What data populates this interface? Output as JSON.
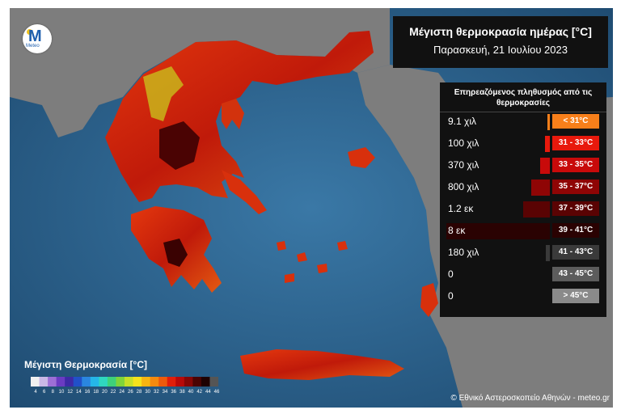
{
  "logo": {
    "letter": "M",
    "text": "Meteo"
  },
  "title": "Μέγιστη θερμοκρασία ημέρας [°C]",
  "subtitle": "Παρασκευή, 21 Ιουλίου 2023",
  "population_panel": {
    "title": "Επηρεαζόμενος πληθυσμός από τις θερμοκρασίες",
    "rows": [
      {
        "population": "9.1 χιλ",
        "range": "< 31°C",
        "color": "#f77f1a",
        "bar_fraction": 0.02
      },
      {
        "population": "100 χιλ",
        "range": "31 - 33°C",
        "color": "#e8190c",
        "bar_fraction": 0.05
      },
      {
        "population": "370 χιλ",
        "range": "33 - 35°C",
        "color": "#c80a0a",
        "bar_fraction": 0.09
      },
      {
        "population": "800 χιλ",
        "range": "35 - 37°C",
        "color": "#8f0505",
        "bar_fraction": 0.18
      },
      {
        "population": "1.2 εκ",
        "range": "37 - 39°C",
        "color": "#5a0303",
        "bar_fraction": 0.26
      },
      {
        "population": "8 εκ",
        "range": "39 - 41°C",
        "color": "#2a0202",
        "bar_fraction": 1.0
      },
      {
        "population": "180 χιλ",
        "range": "41 - 43°C",
        "color": "#3a3a3a",
        "bar_fraction": 0.04
      },
      {
        "population": "0",
        "range": "43 - 45°C",
        "color": "#5c5c5c",
        "bar_fraction": 0.0
      },
      {
        "population": "0",
        "range": "> 45°C",
        "color": "#8a8a8a",
        "bar_fraction": 0.0
      }
    ]
  },
  "colorbar": {
    "title": "Μέγιστη Θερμοκρασία [°C]",
    "ticks": [
      "4",
      "6",
      "8",
      "10",
      "12",
      "14",
      "16",
      "18",
      "20",
      "22",
      "24",
      "26",
      "28",
      "30",
      "32",
      "34",
      "36",
      "38",
      "40",
      "42",
      "44",
      "46"
    ],
    "colors": [
      "#f0f0f0",
      "#c9b8e6",
      "#9d6fd6",
      "#6a3bc2",
      "#3d2aa6",
      "#2150c8",
      "#2a86e0",
      "#25b6e8",
      "#2fd6c0",
      "#3ed17a",
      "#7fd43a",
      "#c5df28",
      "#f4e21c",
      "#f7b512",
      "#f58a0e",
      "#ee5a0b",
      "#e01e0a",
      "#b80909",
      "#860606",
      "#4a0303",
      "#1e0101",
      "#555555"
    ]
  },
  "copyright": "© Εθνικό Αστεροσκοπείο Αθηνών - meteo.gr"
}
